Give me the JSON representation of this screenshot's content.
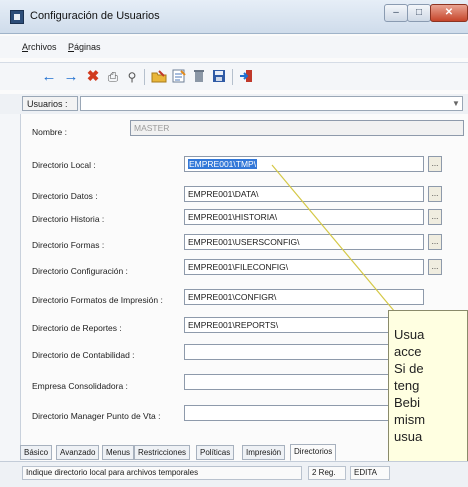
{
  "window": {
    "title": "Configuración de Usuarios",
    "controls": {
      "minimize": "–",
      "maximize": "□",
      "close": "✕"
    }
  },
  "menubar": {
    "items": [
      {
        "label": "Archivos"
      },
      {
        "label": "Páginas"
      }
    ]
  },
  "toolbar": {
    "icons": [
      "back-arrow-icon",
      "forward-arrow-icon",
      "delete-x-icon",
      "print-icon",
      "search-icon",
      "edit-folder-icon",
      "edit-document-icon",
      "trash-icon",
      "save-disk-icon",
      "exit-icon"
    ],
    "colors": {
      "arrows": "#1f6fd0",
      "delete": "#d13b1e",
      "exit": "#c0392b"
    }
  },
  "user_selector": {
    "label": "Usuarios :",
    "value": ""
  },
  "form": {
    "nombre": {
      "label": "Nombre :",
      "value": "MASTER"
    },
    "fields": [
      {
        "key": "dir_local",
        "label": "Directorio Local :",
        "value": "EMPRE001\\TMP\\",
        "has_browse": true,
        "selected": true
      },
      {
        "key": "dir_datos",
        "label": "Directorio Datos :",
        "value": "EMPRE001\\DATA\\",
        "has_browse": true
      },
      {
        "key": "dir_historia",
        "label": "Directorio Historia :",
        "value": "EMPRE001\\HISTORIA\\",
        "has_browse": true
      },
      {
        "key": "dir_formas",
        "label": "Directorio Formas :",
        "value": "EMPRE001\\USERSCONFIG\\",
        "has_browse": true
      },
      {
        "key": "dir_config",
        "label": "Directorio Configuración :",
        "value": "EMPRE001\\FILECONFIG\\",
        "has_browse": true
      },
      {
        "key": "dir_formatos",
        "label": "Directorio Formatos de Impresión :",
        "value": "EMPRE001\\CONFIGR\\",
        "has_browse": false
      },
      {
        "key": "dir_reportes",
        "label": "Directorio de Reportes :",
        "value": "EMPRE001\\REPORTS\\",
        "has_browse": false
      },
      {
        "key": "dir_contabilidad",
        "label": "Directorio de Contabilidad :",
        "value": "",
        "has_browse": false
      },
      {
        "key": "empresa_consolidadora",
        "label": "Empresa Consolidadora :",
        "value": "",
        "has_browse": false
      },
      {
        "key": "dir_manager",
        "label": "Directorio Manager Punto de Vta :",
        "value": "",
        "has_browse": false
      }
    ],
    "browse_label": "..."
  },
  "tooltip": {
    "lines": [
      "Usua",
      "acce",
      "Si de",
      "teng",
      "Bebi",
      "mism",
      "usua"
    ]
  },
  "tabs": [
    {
      "label": "Básico"
    },
    {
      "label": "Avanzado"
    },
    {
      "label": "Menus"
    },
    {
      "label": "Restricciones"
    },
    {
      "label": "Políticas"
    },
    {
      "label": "Impresión"
    },
    {
      "label": "Directorios",
      "active": true
    }
  ],
  "statusbar": {
    "message": "Indique directorio local para archivos temporales",
    "reg": "2 Reg.",
    "mode": "EDITA"
  }
}
